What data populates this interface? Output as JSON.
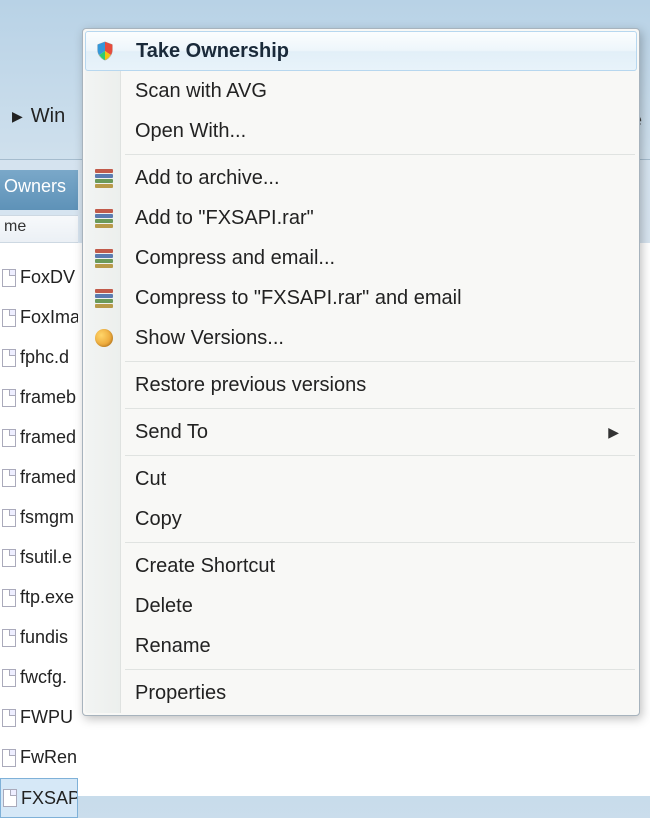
{
  "breadcrumb": {
    "arrow": "▶",
    "label": "Win"
  },
  "toolbar": {
    "label": "Owners"
  },
  "column_header": "me",
  "right_hint_search": "Se",
  "files": [
    "FoxDV",
    "FoxIma",
    "fphc.d",
    "frameb",
    "framed",
    "framed",
    "fsmgm",
    "fsutil.e",
    "ftp.exe",
    "fundis",
    "fwcfg.",
    "FWPU",
    "FwRen",
    "FXSAPI"
  ],
  "menu": [
    {
      "icon": "shield",
      "label": "Take Ownership",
      "highlighted": true
    },
    {
      "label": "Scan with AVG"
    },
    {
      "label": "Open With..."
    },
    {
      "sep": true
    },
    {
      "icon": "rar",
      "label": "Add to archive..."
    },
    {
      "icon": "rar",
      "label": "Add to \"FXSAPI.rar\""
    },
    {
      "icon": "rar",
      "label": "Compress and email..."
    },
    {
      "icon": "rar",
      "label": "Compress to \"FXSAPI.rar\" and email"
    },
    {
      "icon": "versions",
      "label": "Show Versions..."
    },
    {
      "sep": true
    },
    {
      "label": "Restore previous versions"
    },
    {
      "sep": true
    },
    {
      "label": "Send To",
      "submenu": true
    },
    {
      "sep": true
    },
    {
      "label": "Cut"
    },
    {
      "label": "Copy"
    },
    {
      "sep": true
    },
    {
      "label": "Create Shortcut"
    },
    {
      "label": "Delete"
    },
    {
      "label": "Rename"
    },
    {
      "sep": true
    },
    {
      "label": "Properties"
    }
  ]
}
